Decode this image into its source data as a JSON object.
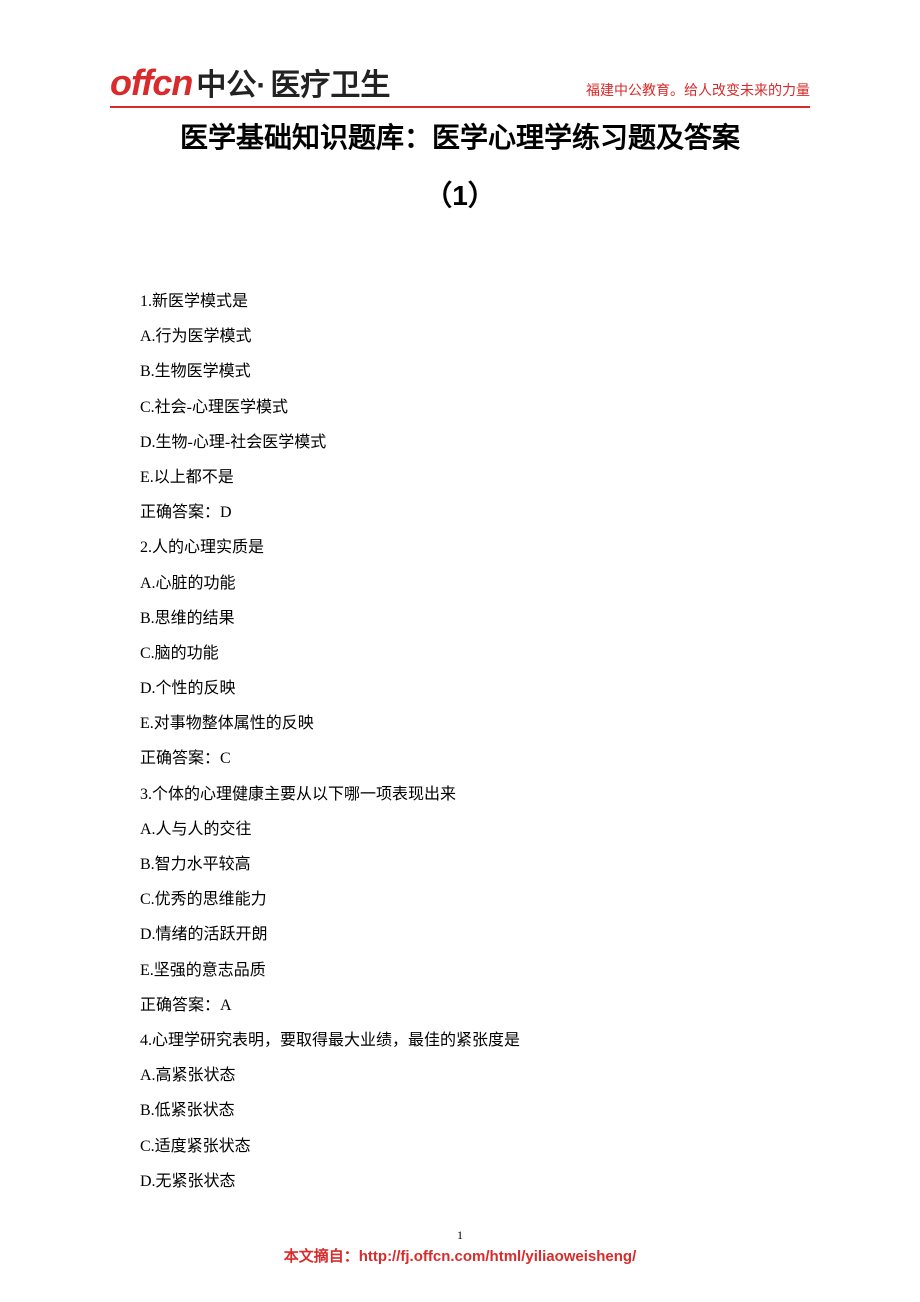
{
  "header": {
    "logo_en": "offcn",
    "logo_cn": "中公·",
    "logo_sub": "医疗卫生",
    "right_text": "福建中公教育。给人改变未来的力量"
  },
  "title": "医学基础知识题库：医学心理学练习题及答案",
  "subtitle": "（1）",
  "questions": [
    {
      "stem": "1.新医学模式是",
      "options": [
        "A.行为医学模式",
        "B.生物医学模式",
        "C.社会-心理医学模式",
        "D.生物-心理-社会医学模式",
        "E.以上都不是"
      ],
      "answer": "正确答案：D"
    },
    {
      "stem": "2.人的心理实质是",
      "options": [
        "A.心脏的功能",
        "B.思维的结果",
        "C.脑的功能",
        "D.个性的反映",
        "E.对事物整体属性的反映"
      ],
      "answer": "正确答案：C"
    },
    {
      "stem": "3.个体的心理健康主要从以下哪一项表现出来",
      "options": [
        "A.人与人的交往",
        "B.智力水平较高",
        "C.优秀的思维能力",
        "D.情绪的活跃开朗",
        "E.坚强的意志品质"
      ],
      "answer": "正确答案：A"
    },
    {
      "stem": "4.心理学研究表明，要取得最大业绩，最佳的紧张度是",
      "options": [
        "A.高紧张状态",
        "B.低紧张状态",
        "C.适度紧张状态",
        "D.无紧张状态"
      ],
      "answer": null
    }
  ],
  "footer": {
    "page_number": "1",
    "label": "本文摘自：",
    "url": "http://fj.offcn.com/html/yiliaoweisheng/"
  }
}
